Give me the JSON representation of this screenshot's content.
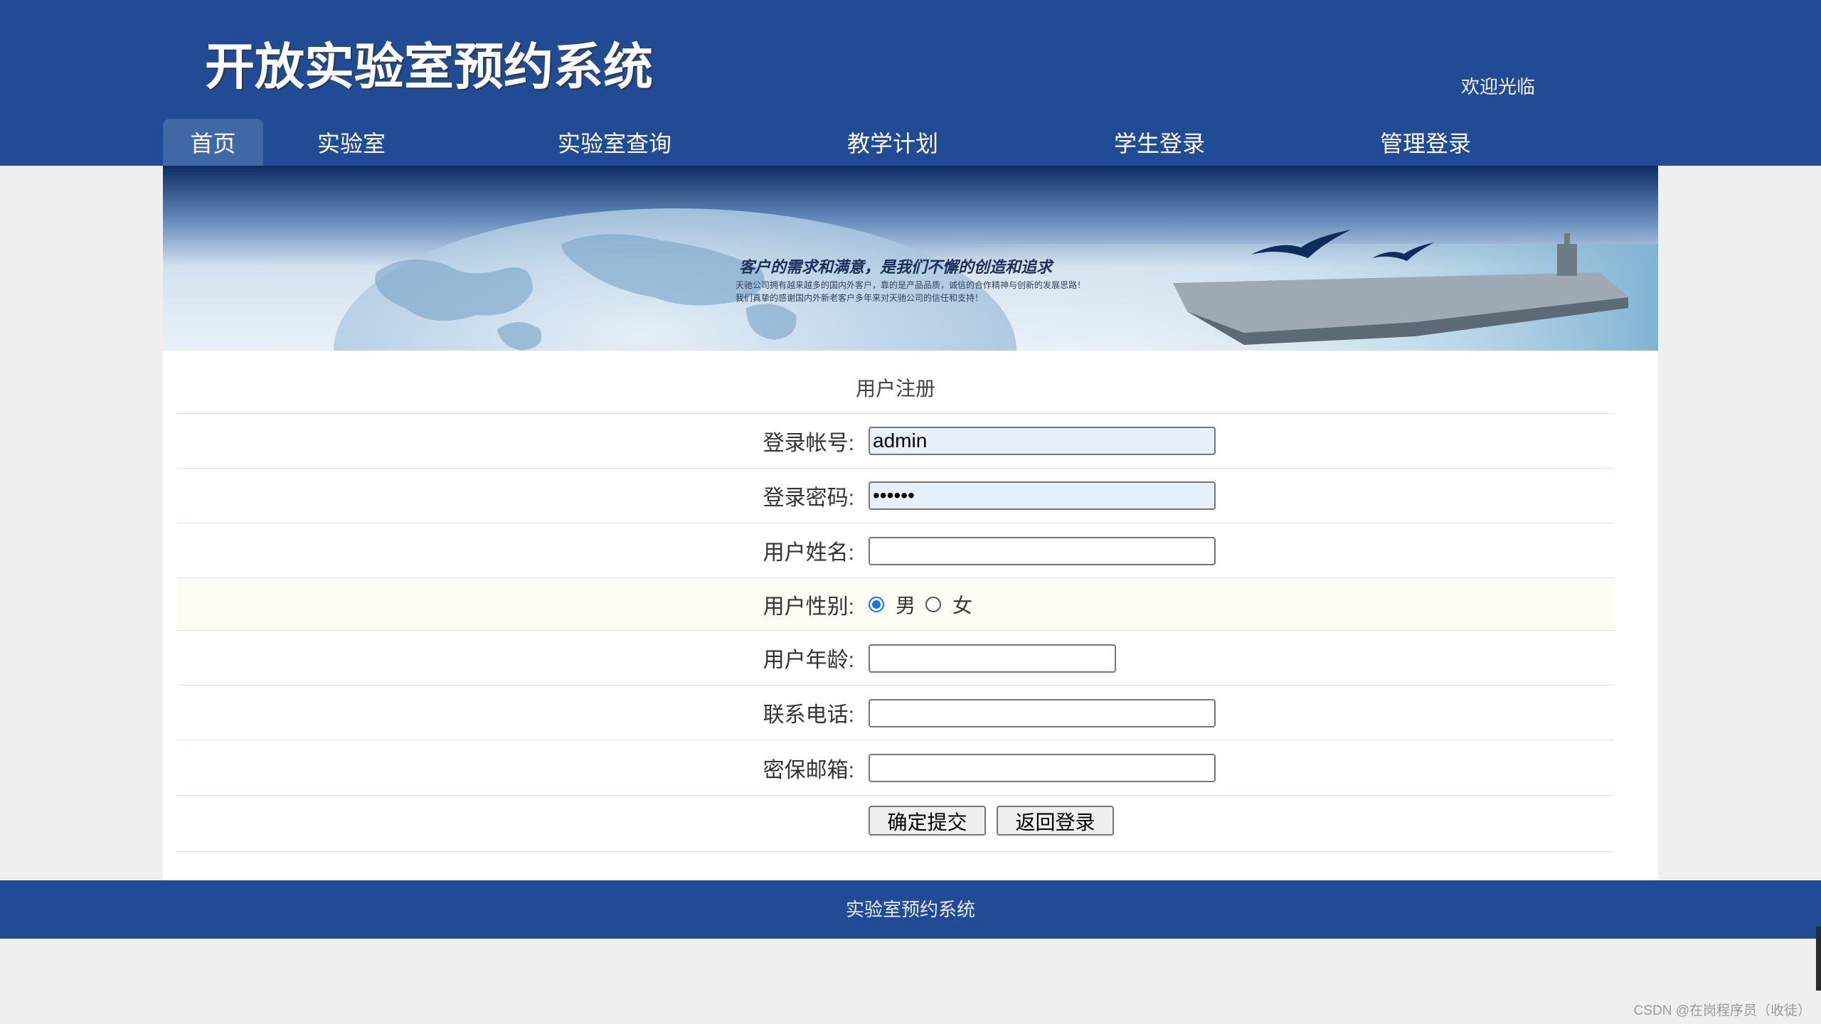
{
  "header": {
    "site_title": "开放实验室预约系统",
    "welcome": "欢迎光临"
  },
  "nav": {
    "items": [
      {
        "label": "首页",
        "active": true
      },
      {
        "label": "实验室",
        "active": false
      },
      {
        "label": "实验室查询",
        "active": false
      },
      {
        "label": "教学计划",
        "active": false
      },
      {
        "label": "学生登录",
        "active": false
      },
      {
        "label": "管理登录",
        "active": false
      }
    ]
  },
  "banner": {
    "slogan": "客户的需求和满意，是我们不懈的创造和追求",
    "line1": "天驰公司拥有越来越多的国内外客户，靠的是产品品质，诚信的合作精神与创新的发展思路！",
    "line2": "我们真挚的感谢国内外新老客户多年来对天驰公司的信任和支持！"
  },
  "form": {
    "title": "用户注册",
    "account_label": "登录帐号:",
    "account_value": "admin",
    "password_label": "登录密码:",
    "password_value": "••••••",
    "name_label": "用户姓名:",
    "name_value": "",
    "gender_label": "用户性别:",
    "gender_options": [
      "男",
      "女"
    ],
    "gender_selected": "男",
    "age_label": "用户年龄:",
    "age_value": "",
    "phone_label": "联系电话:",
    "phone_value": "",
    "email_label": "密保邮箱:",
    "email_value": "",
    "submit_label": "确定提交",
    "back_label": "返回登录"
  },
  "footer": {
    "text": "实验室预约系统"
  },
  "watermark": "CSDN @在岗程序员（收徒）",
  "colors": {
    "header_blue": "#214c95",
    "nav_active": "#3f68a4",
    "page_background": "#efefef",
    "row_border": "#d2e3ef",
    "radio_selected": "#1a73e8"
  }
}
